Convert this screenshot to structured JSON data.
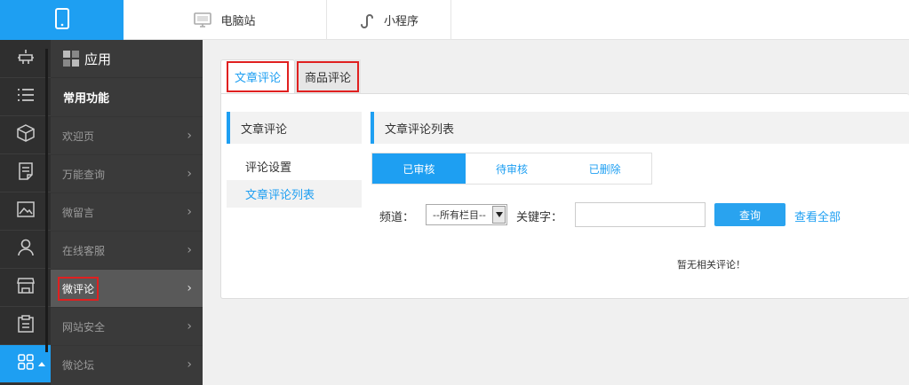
{
  "topbar": {
    "mobile_icon": "mobile-icon",
    "tabs": [
      {
        "label": "电脑站",
        "icon": "monitor-icon"
      },
      {
        "label": "小程序",
        "icon": "link-icon"
      }
    ]
  },
  "rail": {
    "icons": [
      "plugin-icon",
      "list-icon",
      "box-icon",
      "document-icon",
      "image-icon",
      "user-icon",
      "store-icon",
      "clipboard-icon",
      "apps-icon"
    ],
    "active_index": 8
  },
  "submenu": {
    "title": "应用",
    "group": "常用功能",
    "items": [
      {
        "label": "欢迎页"
      },
      {
        "label": "万能查询"
      },
      {
        "label": "微留言"
      },
      {
        "label": "在线客服"
      },
      {
        "label": "微评论"
      },
      {
        "label": "网站安全"
      },
      {
        "label": "微论坛"
      }
    ],
    "active_item": "微评论"
  },
  "content": {
    "tabs": [
      {
        "label": "文章评论"
      },
      {
        "label": "商品评论"
      }
    ],
    "left_panel": {
      "title": "文章评论",
      "items": [
        {
          "label": "评论设置"
        },
        {
          "label": "文章评论列表"
        }
      ]
    },
    "right_panel": {
      "title": "文章评论列表",
      "status_tabs": [
        {
          "label": "已审核"
        },
        {
          "label": "待审核"
        },
        {
          "label": "已删除"
        }
      ],
      "filter": {
        "channel_label": "频道：",
        "channel_value": "--所有栏目--",
        "keyword_label": "关键字：",
        "keyword_value": "",
        "search_label": "查询",
        "view_all_label": "查看全部"
      },
      "empty_text": "暂无相关评论！"
    }
  },
  "colors": {
    "accent": "#1e9ff2",
    "sidebar_dark": "#2f2f2f",
    "submenu_bg": "#3a3a3a",
    "highlight_red": "#e02020"
  }
}
